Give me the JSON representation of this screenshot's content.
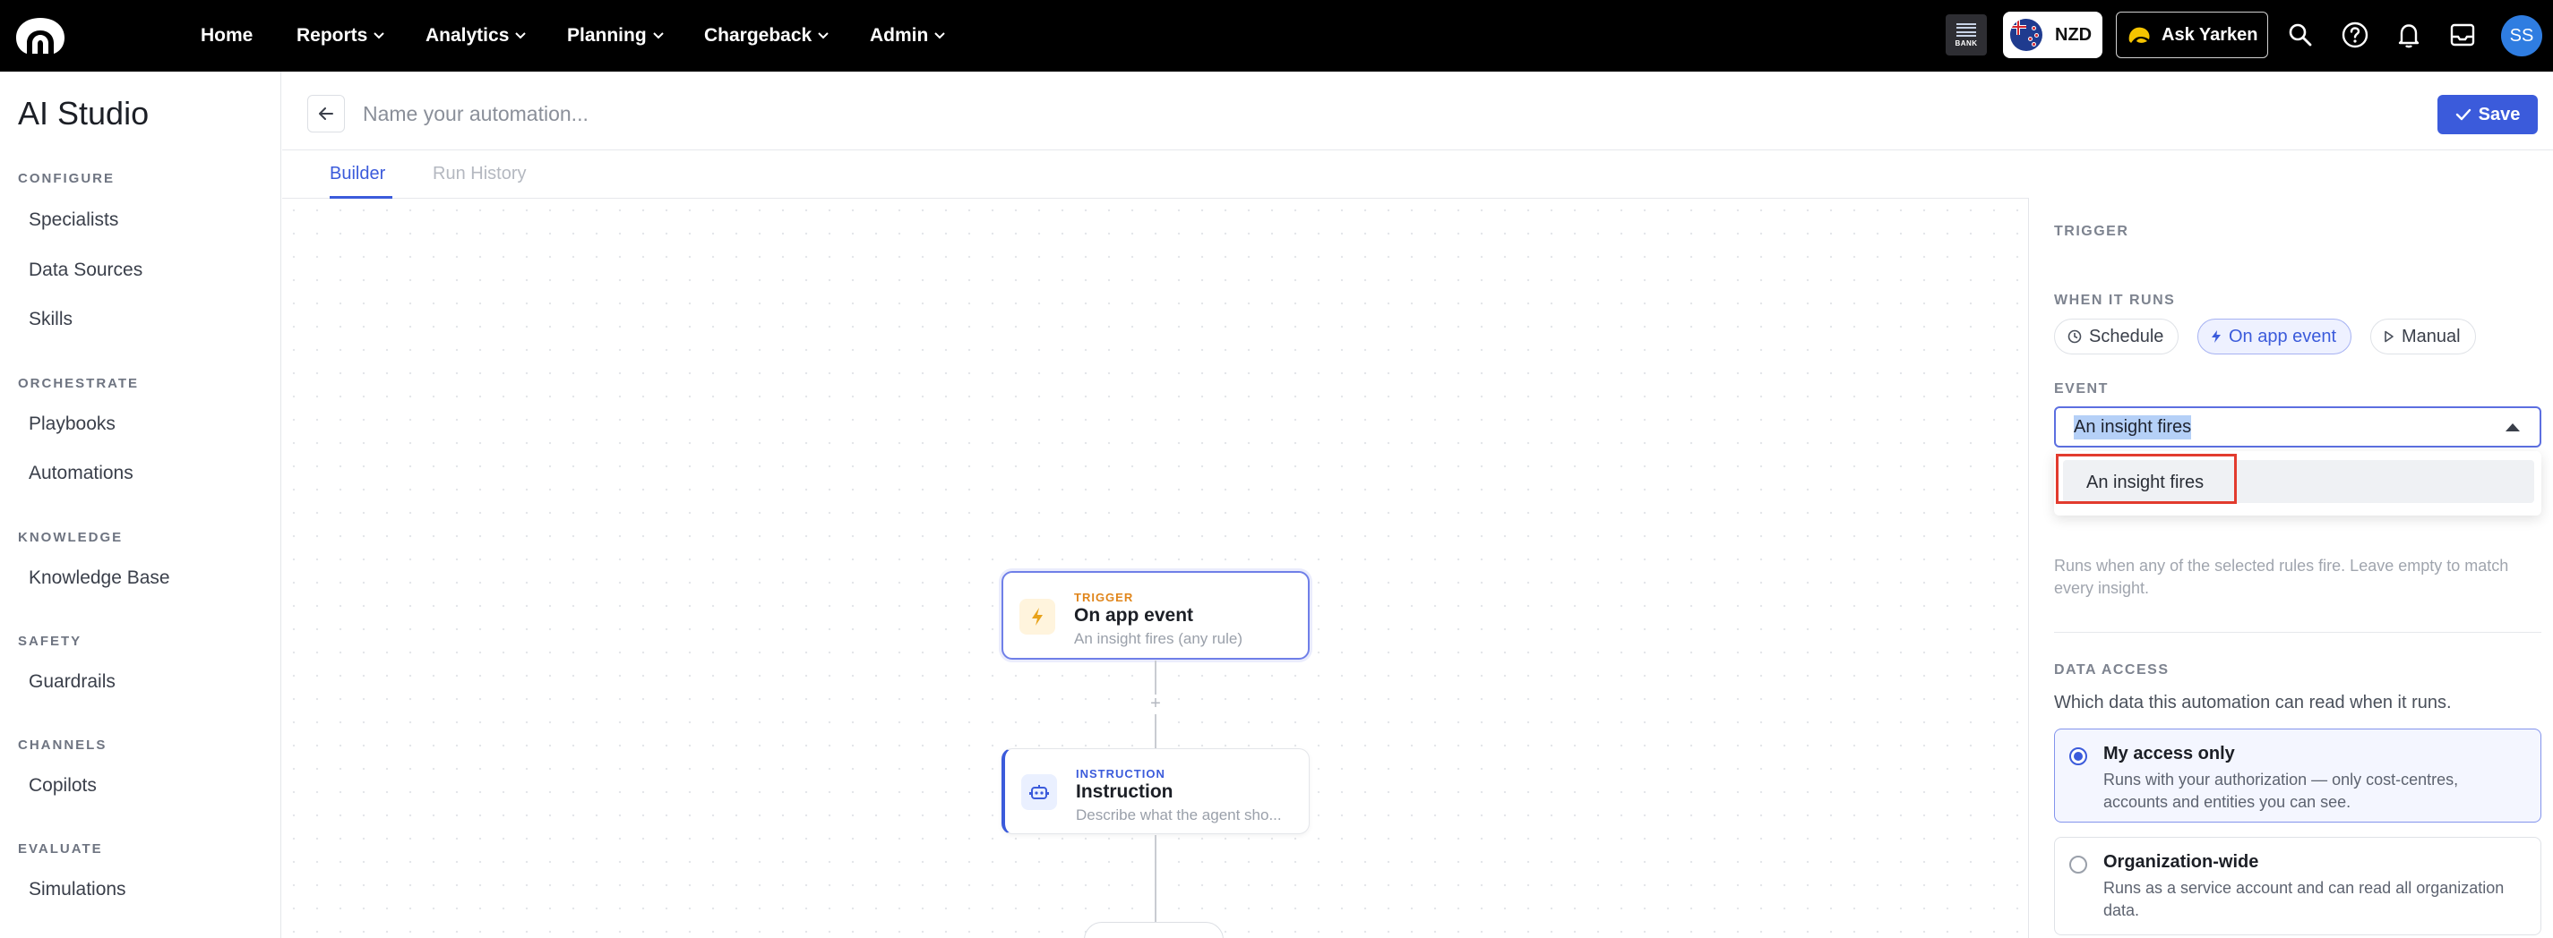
{
  "nav": {
    "items": [
      {
        "label": "Home",
        "has_menu": false
      },
      {
        "label": "Reports",
        "has_menu": true
      },
      {
        "label": "Analytics",
        "has_menu": true
      },
      {
        "label": "Planning",
        "has_menu": true
      },
      {
        "label": "Chargeback",
        "has_menu": true
      },
      {
        "label": "Admin",
        "has_menu": true
      }
    ],
    "bank_label": "BANK",
    "currency": "NZD",
    "ask_label": "Ask Yarken",
    "avatar_initials": "SS"
  },
  "sidebar": {
    "title": "AI Studio",
    "sections": [
      {
        "label": "CONFIGURE",
        "items": [
          "Specialists",
          "Data Sources",
          "Skills"
        ]
      },
      {
        "label": "ORCHESTRATE",
        "items": [
          "Playbooks",
          "Automations"
        ]
      },
      {
        "label": "KNOWLEDGE",
        "items": [
          "Knowledge Base"
        ]
      },
      {
        "label": "SAFETY",
        "items": [
          "Guardrails"
        ]
      },
      {
        "label": "CHANNELS",
        "items": [
          "Copilots"
        ]
      },
      {
        "label": "EVALUATE",
        "items": [
          "Simulations"
        ]
      }
    ]
  },
  "automation": {
    "name_placeholder": "Name your automation...",
    "name_value": "",
    "save_label": "Save"
  },
  "tabs": [
    {
      "label": "Builder",
      "active": true
    },
    {
      "label": "Run History",
      "active": false
    }
  ],
  "canvas": {
    "trigger_node": {
      "kicker": "TRIGGER",
      "title": "On app event",
      "subtitle": "An insight fires (any rule)"
    },
    "instruction_node": {
      "kicker": "INSTRUCTION",
      "title": "Instruction",
      "subtitle": "Describe what the agent sho..."
    },
    "add_symbol": "+"
  },
  "panel": {
    "heading": "TRIGGER",
    "when_label": "WHEN IT RUNS",
    "run_modes": [
      {
        "label": "Schedule",
        "icon": "clock-icon",
        "active": false
      },
      {
        "label": "On app event",
        "icon": "bolt-icon",
        "active": true
      },
      {
        "label": "Manual",
        "icon": "play-icon",
        "active": false
      }
    ],
    "event_label": "EVENT",
    "event_value": "An insight fires",
    "event_options": [
      "An insight fires"
    ],
    "helper_text": "Runs when any of the selected rules fire. Leave empty to match every insight.",
    "data_access_label": "DATA ACCESS",
    "data_access_desc": "Which data this automation can read when it runs.",
    "access_options": [
      {
        "title": "My access only",
        "desc": "Runs with your authorization — only cost-centres, accounts and entities you can see.",
        "selected": true
      },
      {
        "title": "Organization-wide",
        "desc": "Runs as a service account and can read all organization data.",
        "selected": false
      }
    ]
  },
  "colors": {
    "accent": "#3b5bdb",
    "topbar": "#000000",
    "trigger_kicker": "#e0851a",
    "highlight_border": "#e23b2e"
  }
}
